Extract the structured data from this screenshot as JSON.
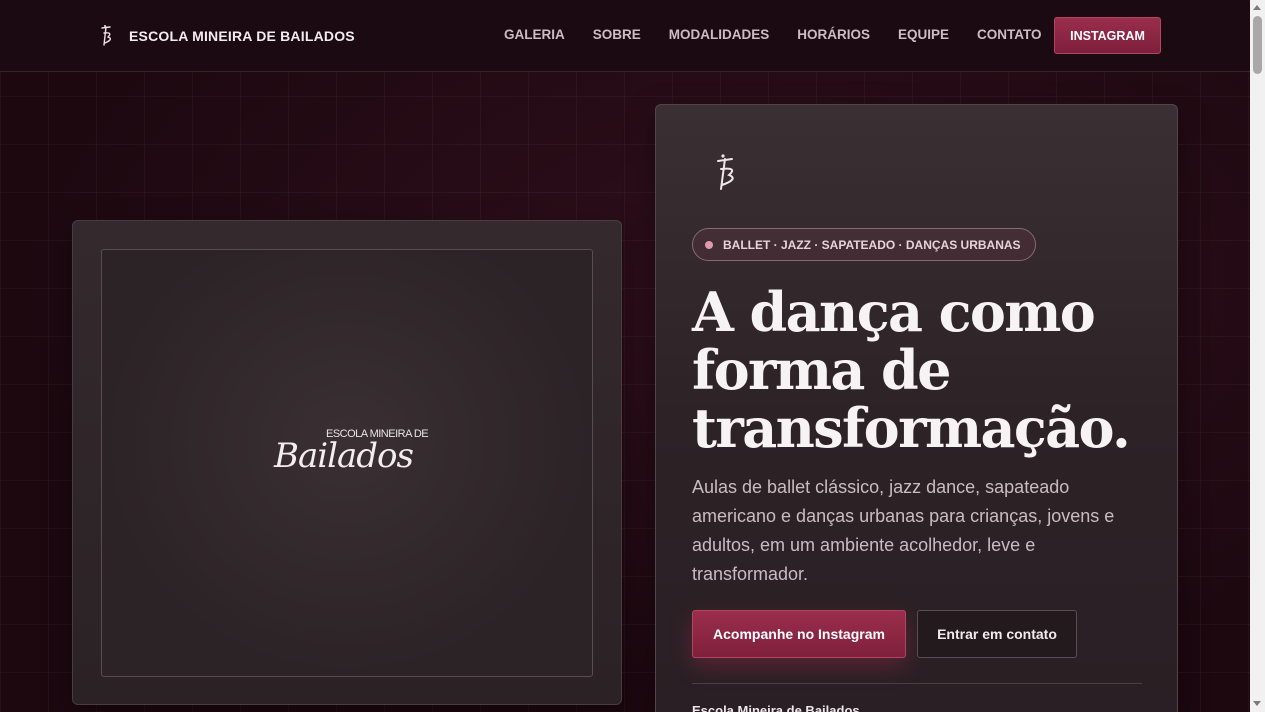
{
  "header": {
    "brand_name": "ESCOLA MINEIRA DE BAILADOS",
    "nav": [
      "GALERIA",
      "SOBRE",
      "MODALIDADES",
      "HORÁRIOS",
      "EQUIPE",
      "CONTATO"
    ],
    "instagram_label": "INSTAGRAM"
  },
  "media": {
    "logo_small": "ESCOLA MINEIRA DE",
    "logo_script": "Bailados"
  },
  "hero": {
    "badge": "BALLET · JAZZ · SAPATEADO · DANÇAS URBANAS",
    "title_line1": "A dança como",
    "title_line2": "forma de",
    "title_line3": "transformação.",
    "description": "Aulas de ballet clássico, jazz dance, sapateado americano e danças urbanas para crianças, jovens e adultos, em um ambiente acolhedor, leve e transformador.",
    "primary_cta": "Acompanhe no Instagram",
    "secondary_cta": "Entrar em contato",
    "footer_name": "Escola Mineira de Bailados"
  },
  "colors": {
    "accent": "#8f2846",
    "background": "#220a13",
    "card": "#2d2327"
  },
  "icons": {
    "brand": "dancer-monogram-icon"
  }
}
